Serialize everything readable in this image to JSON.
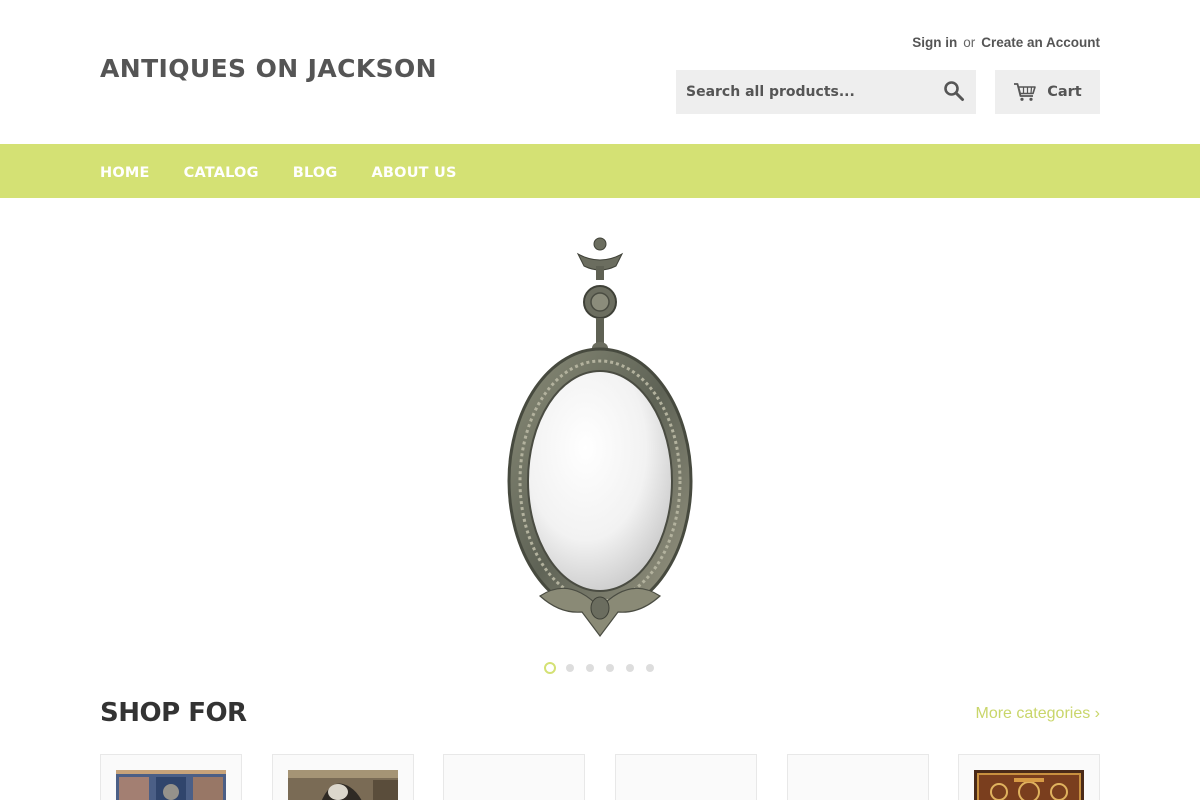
{
  "header": {
    "site_title": "ANTIQUES ON JACKSON",
    "sign_in": "Sign in",
    "or": "or",
    "create_account": "Create an Account",
    "search_placeholder": "Search all products...",
    "cart_label": "Cart"
  },
  "nav": {
    "items": [
      "HOME",
      "CATALOG",
      "BLOG",
      "ABOUT US"
    ]
  },
  "slideshow": {
    "slide_count": 6,
    "active_index": 0,
    "image": "ornate oval wall mirror"
  },
  "shop": {
    "title": "SHOP FOR",
    "more_link": "More categories ›",
    "categories": [
      {
        "image": "blue tile panel"
      },
      {
        "image": "painting"
      },
      {
        "image": ""
      },
      {
        "image": ""
      },
      {
        "image": ""
      },
      {
        "image": "carved box"
      }
    ]
  },
  "colors": {
    "accent": "#d4e174",
    "link_accent": "#c9d66a",
    "text": "#555555",
    "input_bg": "#eeeeee"
  },
  "icons": {
    "search": "search-icon",
    "cart": "cart-icon"
  }
}
